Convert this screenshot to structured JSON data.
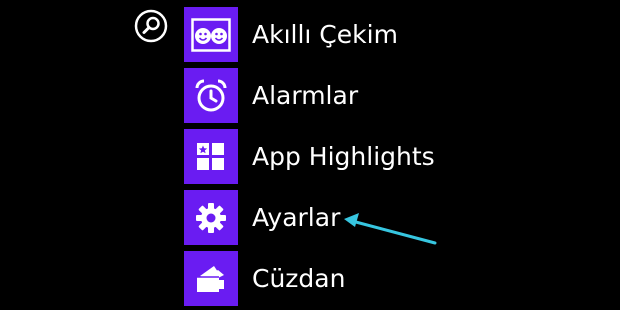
{
  "search": {
    "icon": "search-icon"
  },
  "apps": [
    {
      "label": "Akıllı Çekim",
      "icon": "smile-faces-icon"
    },
    {
      "label": "Alarmlar",
      "icon": "alarm-clock-icon"
    },
    {
      "label": "App Highlights",
      "icon": "grid-tiles-icon"
    },
    {
      "label": "Ayarlar",
      "icon": "gear-icon"
    },
    {
      "label": "Cüzdan",
      "icon": "wallet-icon"
    }
  ],
  "colors": {
    "background": "#000000",
    "tile": "#6a1cf2",
    "text": "#ffffff",
    "annotation_arrow": "#37c6e0"
  }
}
